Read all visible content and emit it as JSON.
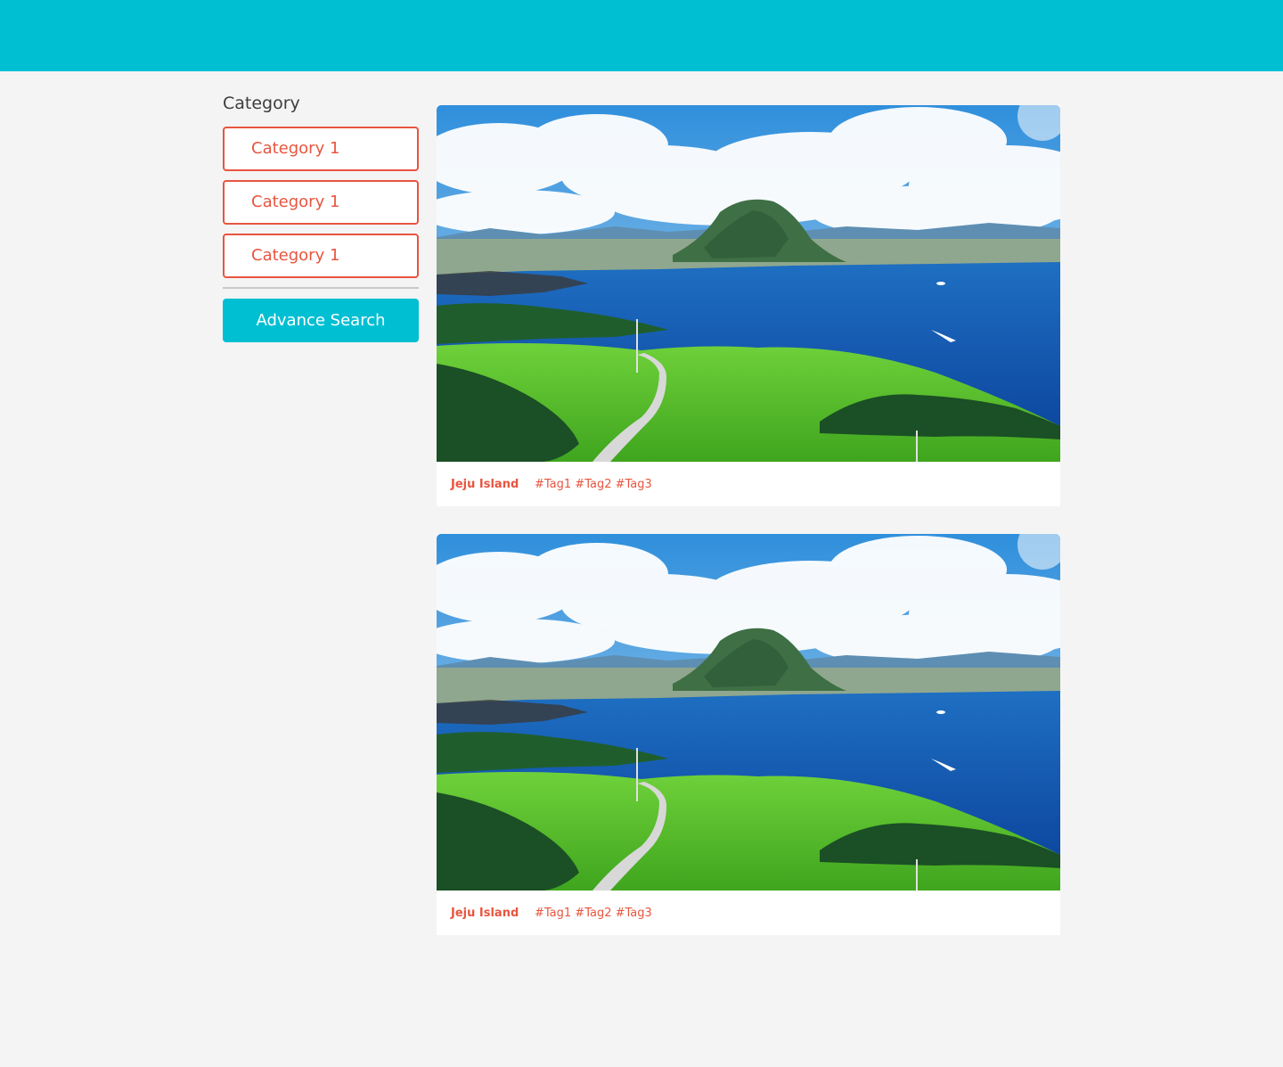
{
  "header": {
    "color": "#00bfd3"
  },
  "sidebar": {
    "title": "Category",
    "categories": [
      {
        "label": "Category 1"
      },
      {
        "label": "Category 1"
      },
      {
        "label": "Category 1"
      }
    ],
    "advance_search_label": "Advance Search",
    "accent_color": "#e8553f"
  },
  "cards": [
    {
      "image": "landscape-photo",
      "title": "Jeju Island",
      "tags": "#Tag1 #Tag2 #Tag3"
    },
    {
      "image": "landscape-photo",
      "title": "Jeju Island",
      "tags": "#Tag1 #Tag2 #Tag3"
    }
  ]
}
